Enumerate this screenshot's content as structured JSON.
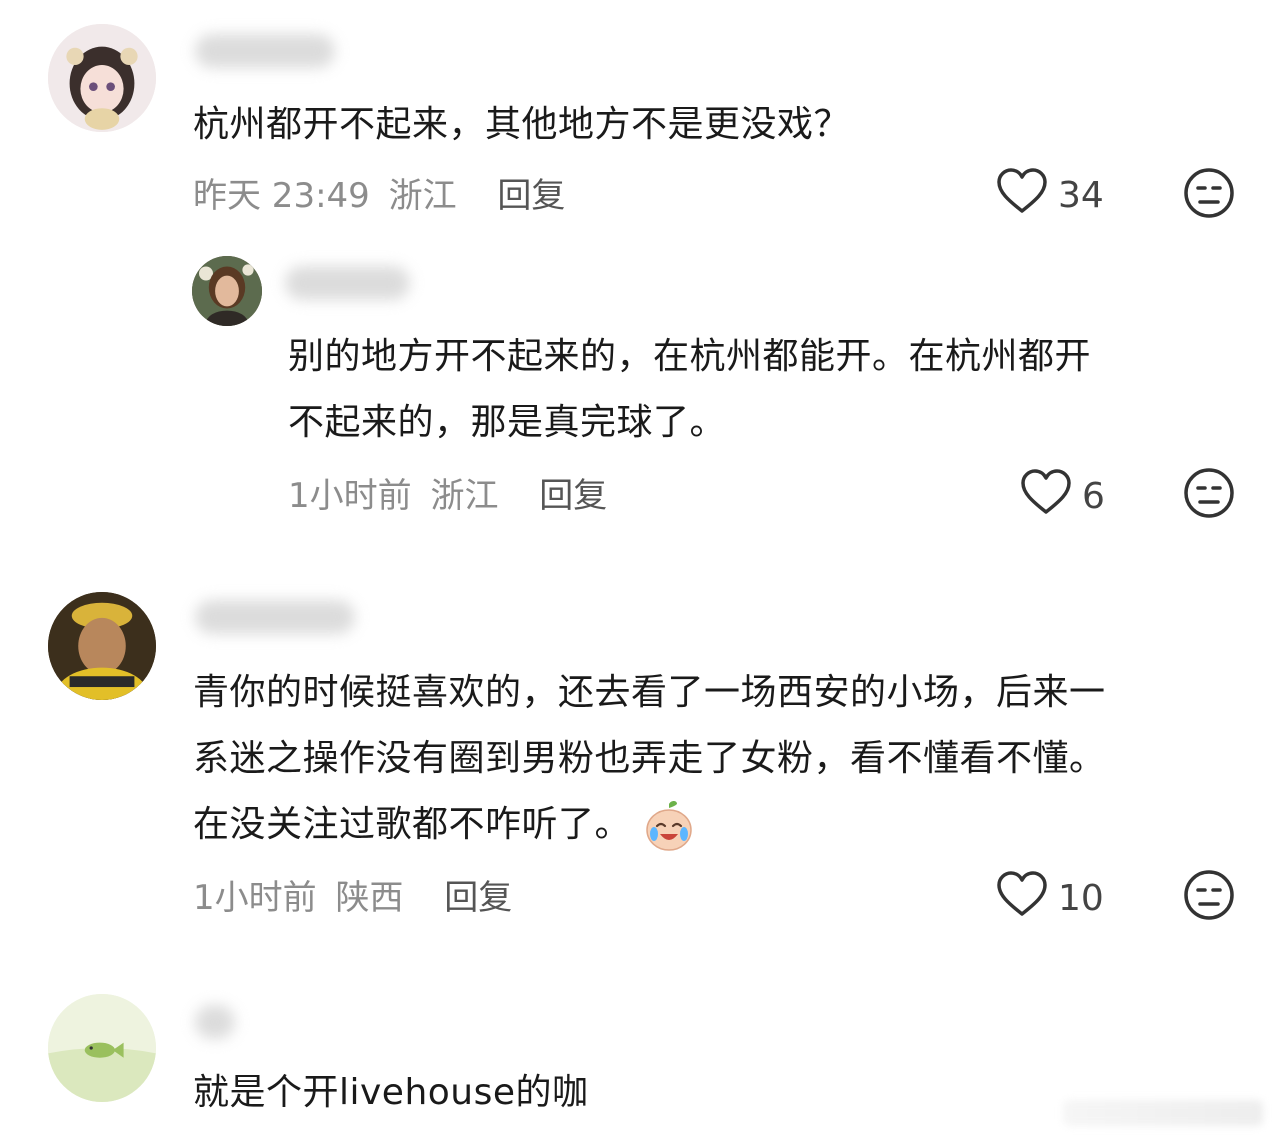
{
  "comments": [
    {
      "text_lines": [
        "杭州都开不起来，其他地方不是更没戏？"
      ],
      "time": "昨天 23:49",
      "location": "浙江",
      "reply_label": "回复",
      "likes": "34"
    },
    {
      "text_lines": [
        "别的地方开不起来的，在杭州都能开。在杭州都开",
        "不起来的，那是真完球了。"
      ],
      "time": "1小时前",
      "location": "浙江",
      "reply_label": "回复",
      "likes": "6"
    },
    {
      "text_lines": [
        "青你的时候挺喜欢的，还去看了一场西安的小场，后来一",
        "系迷之操作没有圈到男粉也弄走了女粉，看不懂看不懂。",
        "在没关注过歌都不咋听了。"
      ],
      "time": "1小时前",
      "location": "陕西",
      "reply_label": "回复",
      "likes": "10",
      "emoji": "crying-laughing-emoji"
    },
    {
      "text_lines": [
        "就是个开livehouse的咖"
      ]
    }
  ],
  "icons": {
    "like": "heart-outline-icon",
    "dislike": "meh-face-icon"
  },
  "colors": {
    "text": "#1a1a1a",
    "meta": "#8c8c8c",
    "icon": "#333333"
  }
}
